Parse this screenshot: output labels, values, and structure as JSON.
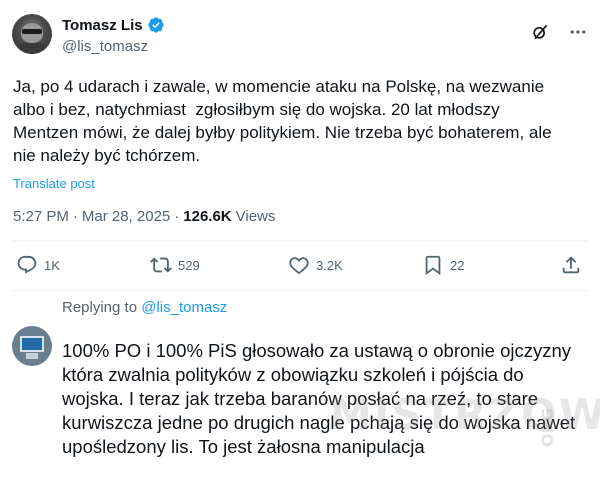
{
  "post": {
    "author": {
      "name": "Tomasz Lis",
      "handle": "@lis_tomasz"
    },
    "text": "Ja, po 4 udarach i zawale, w momencie ataku na Polskę, na wezwanie\nalbo i bez, natychmiast  zgłosiłbym się do wojska. 20 lat młodszy\nMentzen mówi, że dalej byłby politykiem. Nie trzeba być bohaterem, ale\nnie należy być tchórzem.",
    "translate_label": "Translate post",
    "time": "5:27 PM",
    "date": "Mar 28, 2025",
    "views_count": "126.6K",
    "views_label": "Views",
    "actions": {
      "replies": "1K",
      "reposts": "529",
      "likes": "3.2K",
      "bookmarks": "22"
    }
  },
  "reply": {
    "replying_to_label": "Replying to",
    "replying_to_handle": "@lis_tomasz",
    "text": "100% PO i 100% PiS głosowało za ustawą o obronie ojczyzny która zwalnia polityków z obowiązku szkoleń i pójścia do wojska. I teraz jak trzeba baranów posłać na rzeź, to stare kurwiszcza jedne po drugich nagle pchają się do wojska nawet upośledzony lis. To jest żałosna manipulacja"
  },
  "watermark": {
    "main": "MISTRZOWIE",
    "small": "ORG"
  },
  "colors": {
    "accent": "#1d9bf0",
    "muted": "#536471",
    "text": "#0f1419",
    "divider": "#eff3f4"
  },
  "icons": [
    "verified-badge-icon",
    "grok-icon",
    "more-icon",
    "reply-icon",
    "repost-icon",
    "like-icon",
    "bookmark-icon",
    "share-icon"
  ]
}
